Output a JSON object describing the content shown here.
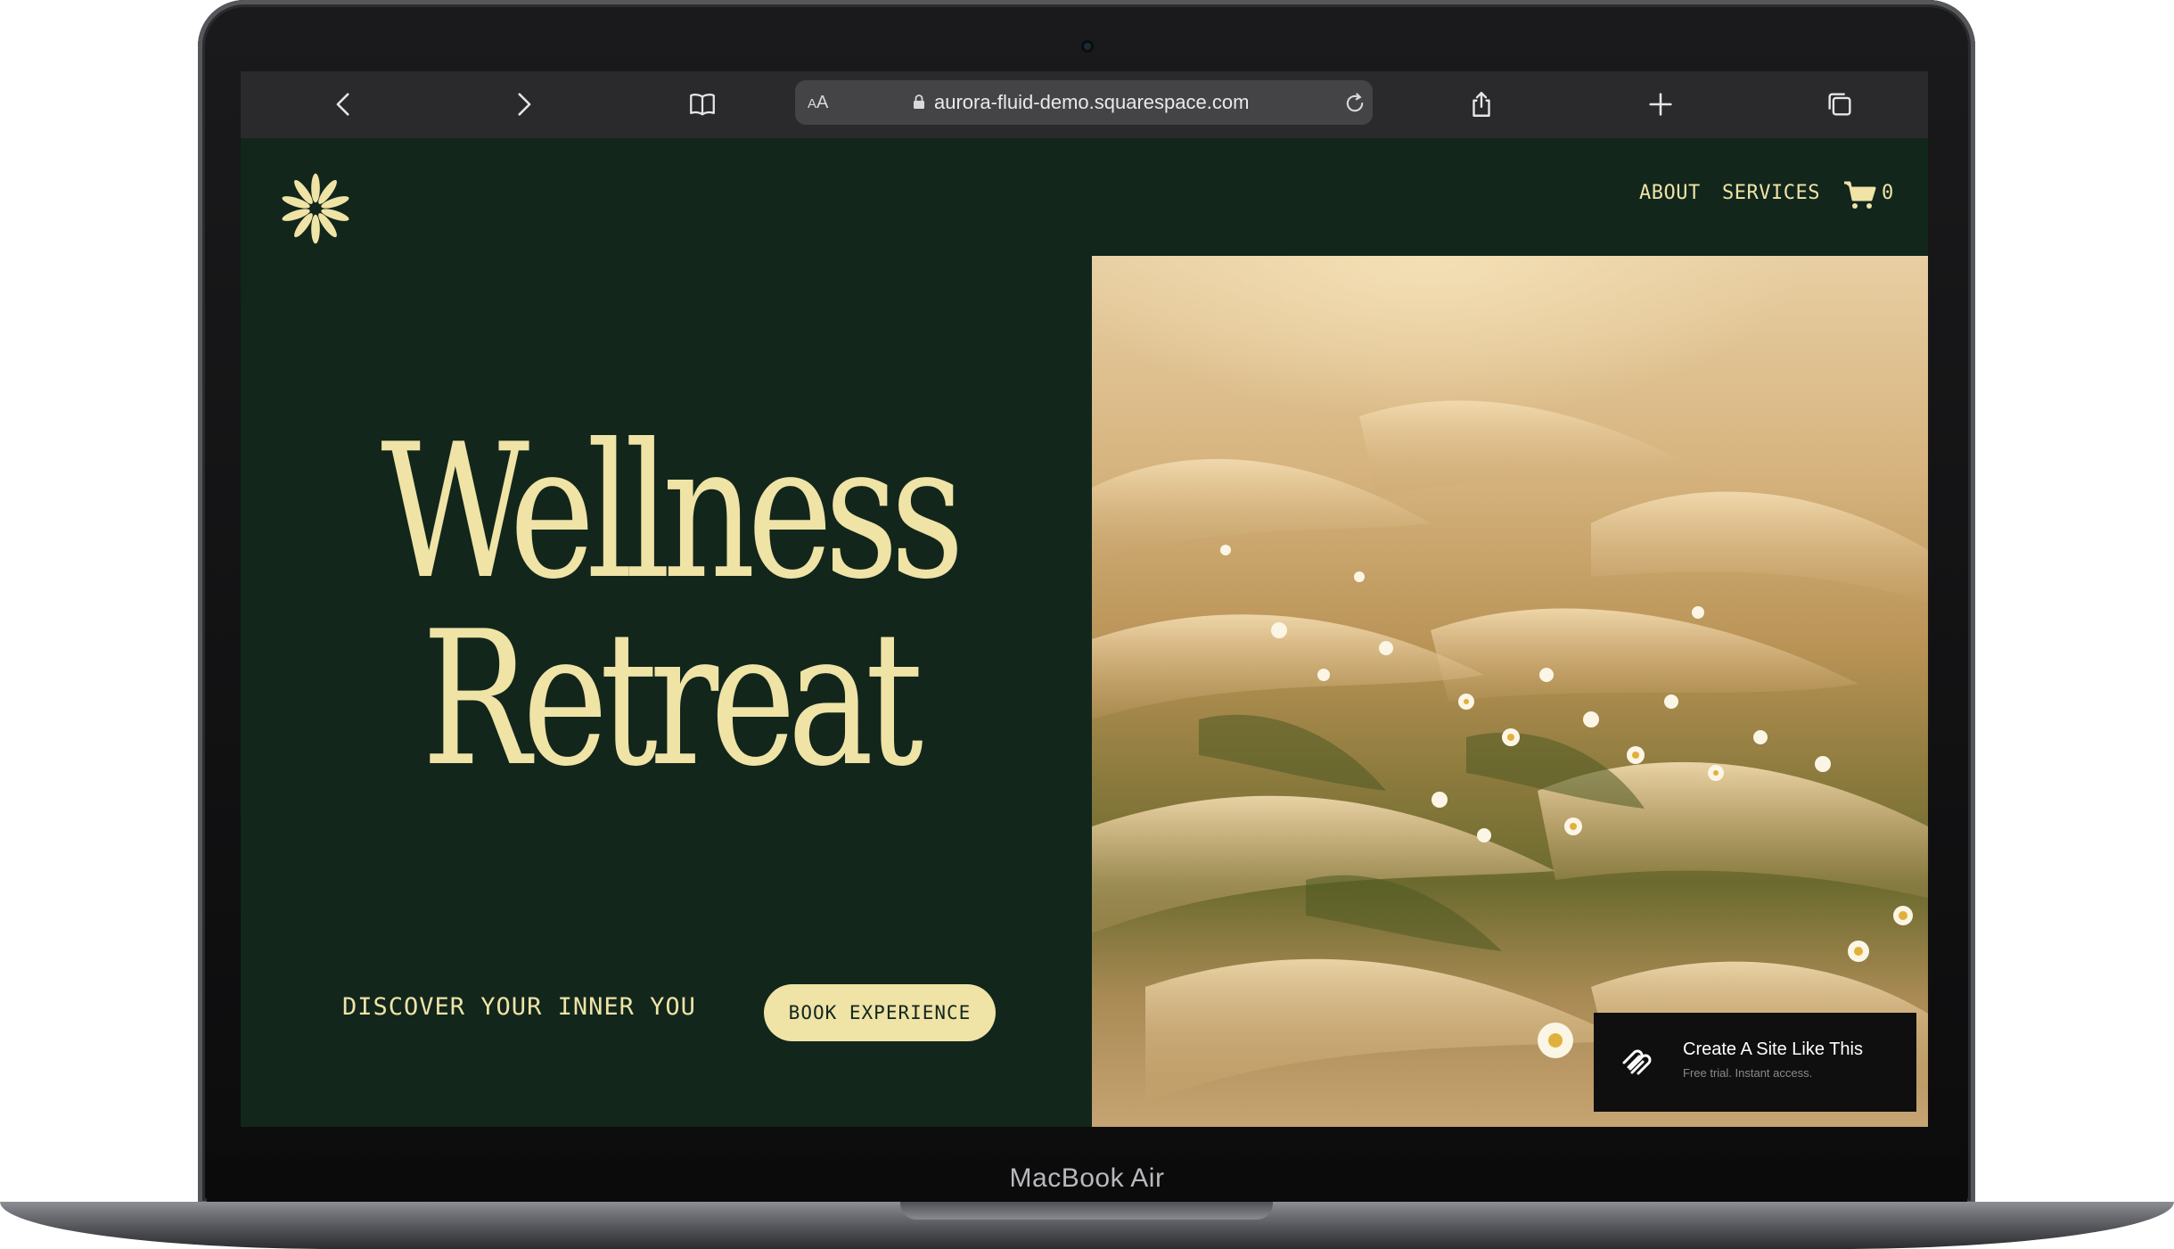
{
  "device": {
    "label": "MacBook Air"
  },
  "browser": {
    "url": "aurora-fluid-demo.squarespace.com",
    "reader_label_small": "A",
    "reader_label_large": "A",
    "icons": [
      "back-icon",
      "forward-icon",
      "bookmarks-icon",
      "lock-icon",
      "reload-icon",
      "share-icon",
      "new-tab-icon",
      "tabs-icon"
    ]
  },
  "site": {
    "nav": {
      "about": "ABOUT",
      "services": "SERVICES",
      "cart_count": "0"
    },
    "hero": {
      "title_line1": "Wellness",
      "title_line2": "Retreat",
      "tagline": "DISCOVER YOUR INNER YOU",
      "cta": "BOOK EXPERIENCE"
    },
    "badge": {
      "title": "Create A Site Like This",
      "subtitle": "Free trial. Instant access."
    },
    "colors": {
      "background": "#12261c",
      "accent": "#efe3a6",
      "toolbar": "#2a2a2c"
    }
  }
}
